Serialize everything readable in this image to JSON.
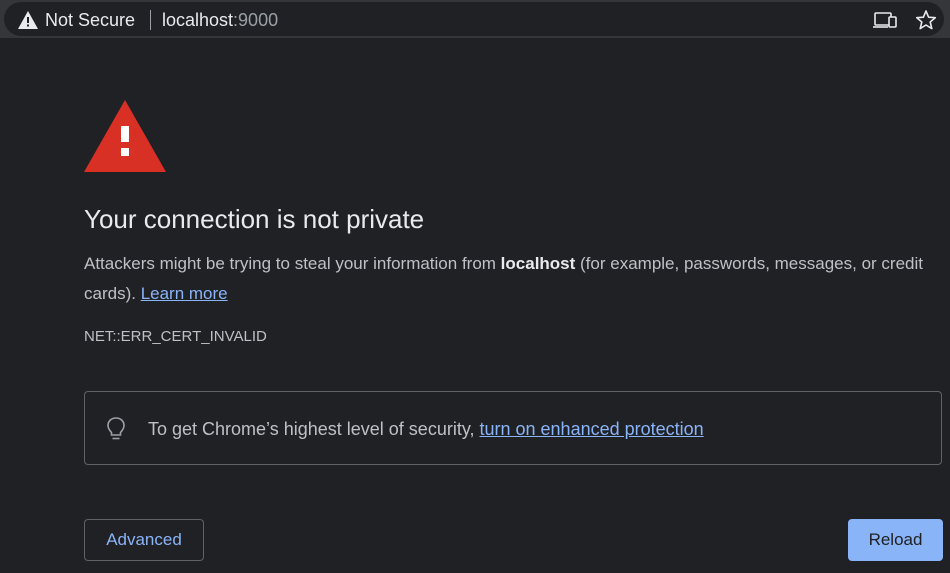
{
  "browser": {
    "security_label": "Not Secure",
    "url_host": "localhost",
    "url_port": ":9000",
    "icons": [
      "warning-icon",
      "install-app-icon",
      "bookmark-star-icon"
    ]
  },
  "page": {
    "heading": "Your connection is not private",
    "description_pre": "Attackers might be trying to steal your information from ",
    "description_host": "localhost",
    "description_post": " (for example, passwords, messages, or credit cards). ",
    "learn_more": "Learn more",
    "error_code": "NET::ERR_CERT_INVALID",
    "enhanced_text": "To get Chrome’s highest level of security, ",
    "enhanced_link": "turn on enhanced protection",
    "advanced_button": "Advanced",
    "reload_button": "Reload"
  },
  "colors": {
    "background": "#202124",
    "warning_red": "#d93025",
    "link_blue": "#8ab4f8"
  }
}
